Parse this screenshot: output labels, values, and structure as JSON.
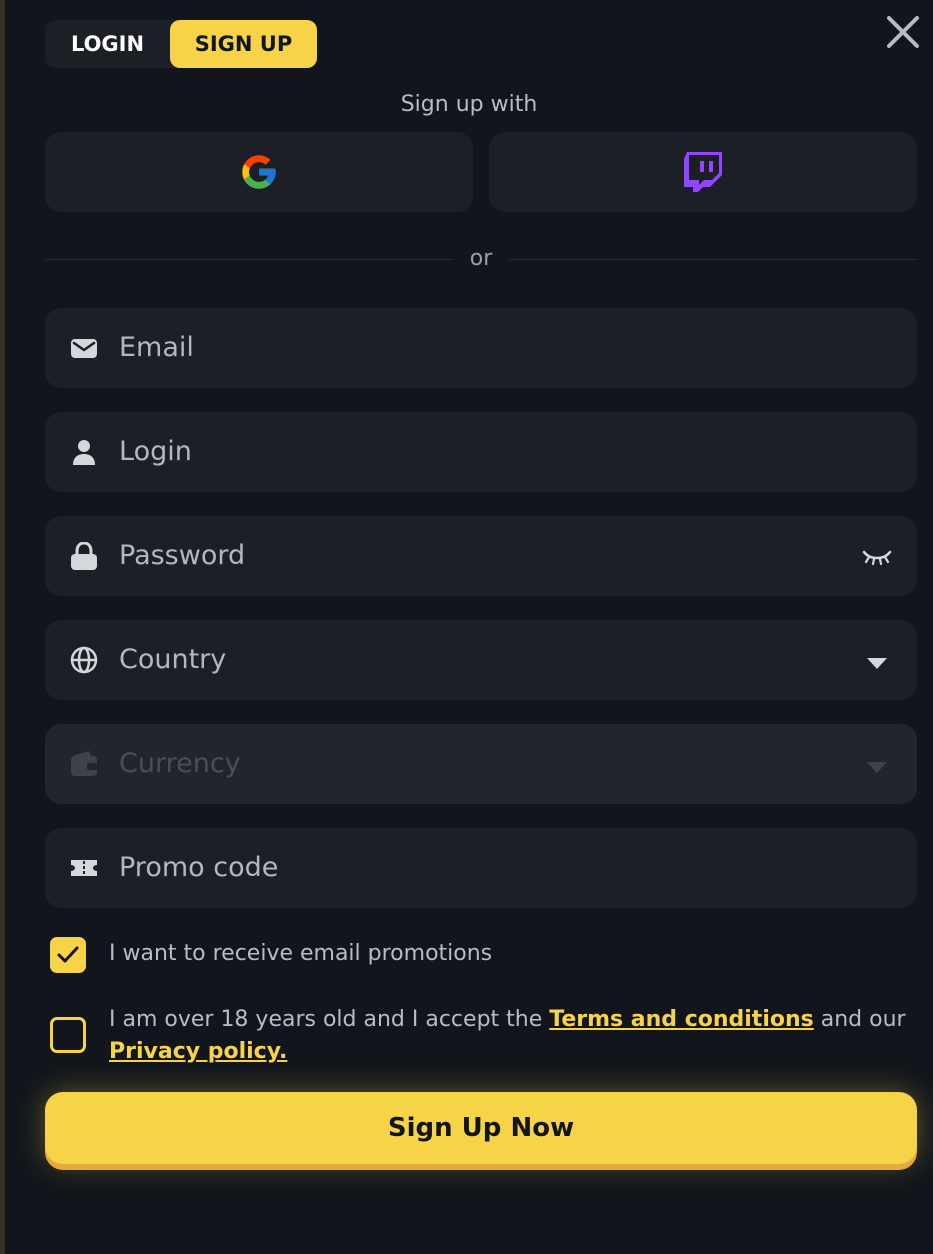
{
  "tabs": {
    "login": "LOGIN",
    "signup": "SIGN UP",
    "active": "signup"
  },
  "social": {
    "heading": "Sign up with",
    "providers": [
      "google-icon",
      "twitch-icon"
    ]
  },
  "divider_text": "or",
  "fields": {
    "email": {
      "placeholder": "Email",
      "icon": "envelope-icon"
    },
    "login": {
      "placeholder": "Login",
      "icon": "user-icon"
    },
    "password": {
      "placeholder": "Password",
      "icon": "lock-icon",
      "toggle_icon": "eye-closed-icon"
    },
    "country": {
      "placeholder": "Country",
      "icon": "globe-icon",
      "dropdown_icon": "caret-down-icon"
    },
    "currency": {
      "placeholder": "Currency",
      "icon": "wallet-icon",
      "dropdown_icon": "caret-down-icon",
      "disabled": true
    },
    "promo": {
      "placeholder": "Promo code",
      "icon": "ticket-icon"
    }
  },
  "checkboxes": {
    "promotions": {
      "label": "I want to receive email promotions",
      "checked": true
    },
    "terms": {
      "text_before": "I am over 18 years old and I accept the ",
      "terms_link": "Terms and conditions",
      "text_middle": " and our ",
      "privacy_link": "Privacy policy.",
      "checked": false
    }
  },
  "submit_label": "Sign Up Now",
  "colors": {
    "background": "#12161c",
    "field": "#1c2026",
    "accent": "#f6d347",
    "accent_shadow": "#e6a93a",
    "twitch": "#9146ff"
  }
}
